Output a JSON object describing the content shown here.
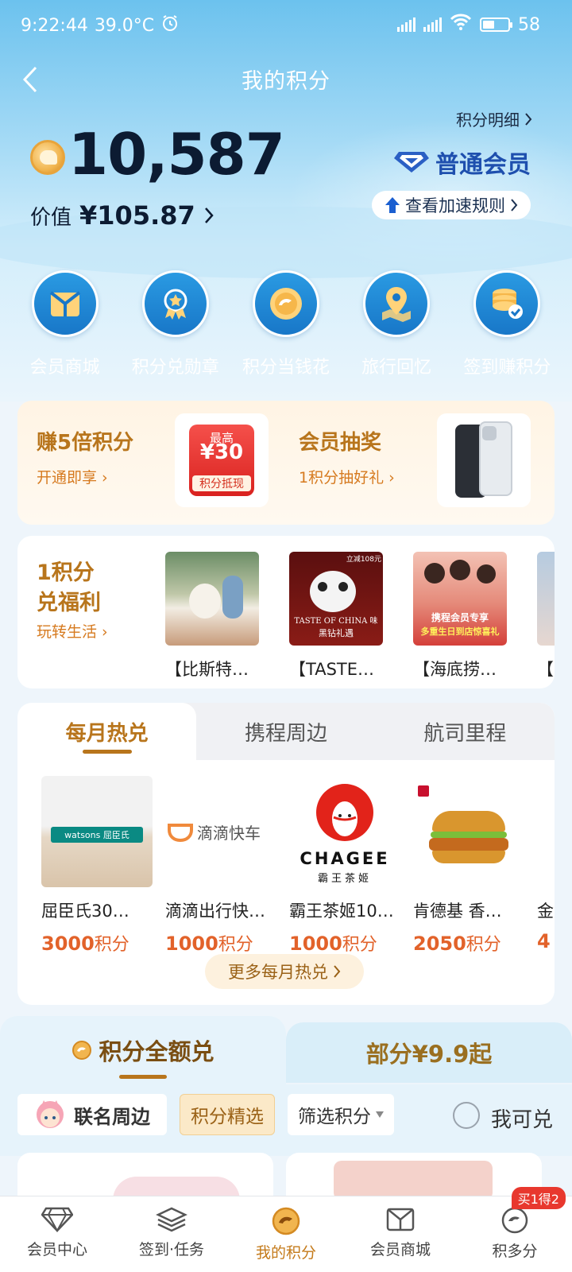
{
  "status_bar": {
    "time": "9:22:44",
    "temp": "39.0°C",
    "battery": "58"
  },
  "header": {
    "title": "我的积分"
  },
  "points": {
    "value": "10,587",
    "worth_label": "价值",
    "worth_value": "¥105.87",
    "detail_link": "积分明细",
    "member_level": "普通会员",
    "speed_rule": "查看加速规则"
  },
  "quick_actions": [
    {
      "label": "会员商城",
      "icon": "mall-icon"
    },
    {
      "label": "积分兑勋章",
      "icon": "medal-icon"
    },
    {
      "label": "积分当钱花",
      "icon": "coin-icon"
    },
    {
      "label": "旅行回忆",
      "icon": "map-pin-icon"
    },
    {
      "label": "签到赚积分",
      "icon": "coin-stack-icon"
    }
  ],
  "promo": {
    "left_title": "赚5倍积分",
    "left_sub": "开通即享",
    "coupon_top": "最高",
    "coupon_amount": "¥30",
    "coupon_bottom": "积分抵现",
    "right_title": "会员抽奖",
    "right_sub": "1积分抽好礼"
  },
  "benefits": {
    "title_line1": "1积分",
    "title_line2": "兑福利",
    "link": "玩转生活",
    "items": [
      {
        "name": "【比斯特…"
      },
      {
        "name": "【TASTE…",
        "img_text_1": "TASTE OF CHINA 味",
        "img_text_2": "黑钻礼遇",
        "img_tag": "立减108元"
      },
      {
        "name": "【海底捞…",
        "img_text_1": "携程会员专享",
        "img_text_2": "多重生日到店惊喜礼"
      },
      {
        "name": "【"
      }
    ]
  },
  "hot_section": {
    "tabs": [
      "每月热兑",
      "携程周边",
      "航司里程"
    ],
    "active_tab": 0,
    "items": [
      {
        "name": "屈臣氏30…",
        "points": "3000",
        "unit": "积分",
        "logo": "watsons 屈臣氏"
      },
      {
        "name": "滴滴出行快…",
        "points": "1000",
        "unit": "积分",
        "logo": "滴滴快车"
      },
      {
        "name": "霸王茶姬10…",
        "points": "1000",
        "unit": "积分",
        "logo": "CHAGEE",
        "logo_sub": "霸王茶姬"
      },
      {
        "name": "肯德基 香…",
        "points": "2050",
        "unit": "积分"
      },
      {
        "name": "金",
        "points": "4",
        "unit": ""
      }
    ],
    "more_label": "更多每月热兑"
  },
  "full_redeem": {
    "left_tab": "积分全额兑",
    "right_tab": "部分¥9.9起"
  },
  "filters": {
    "chip1": "联名周边",
    "chip2": "积分精选",
    "chip3": "筛选积分",
    "toggle_label": "我可兑"
  },
  "bottom_nav": {
    "items": [
      "会员中心",
      "签到·任务",
      "我的积分",
      "会员商城",
      "积多分"
    ],
    "active": 2,
    "badge": "买1得2"
  },
  "colors": {
    "accent_gold": "#b8751c",
    "price_orange": "#e2622a",
    "hero_blue": "#6cc2ee"
  }
}
